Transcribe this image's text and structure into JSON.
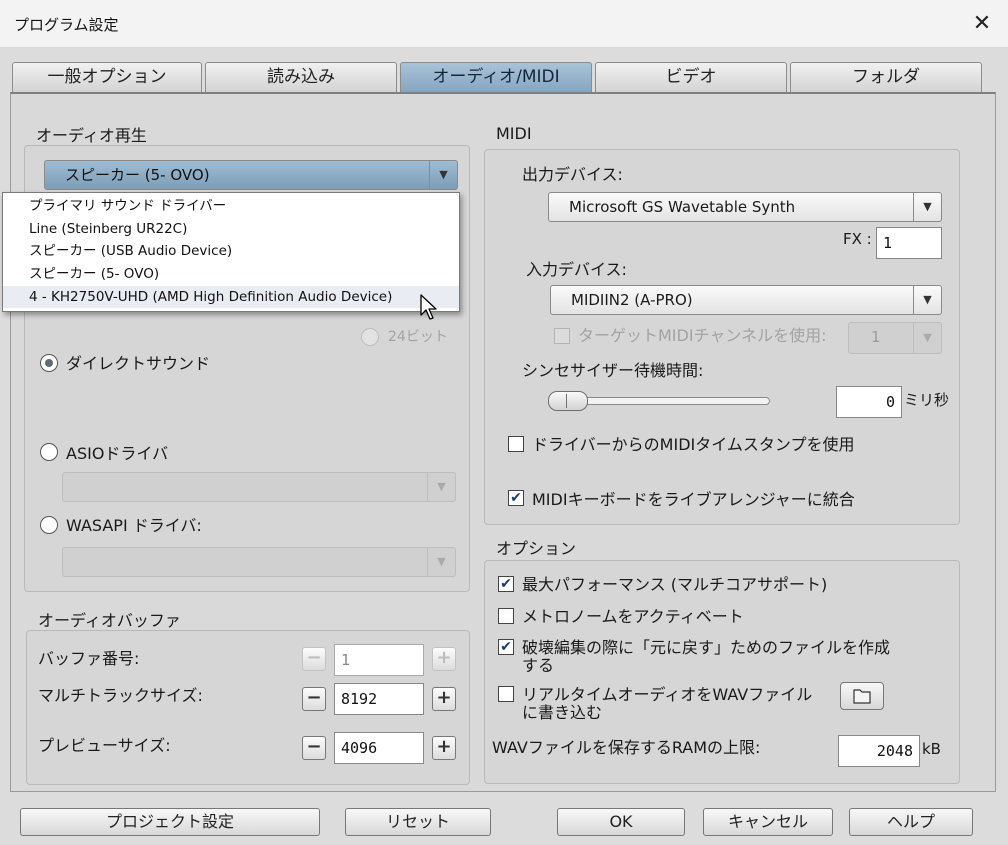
{
  "window": {
    "title": "プログラム設定",
    "close_glyph": "✕"
  },
  "tabs": [
    "一般オプション",
    "読み込み",
    "オーディオ/MIDI",
    "ビデオ",
    "フォルダ"
  ],
  "audio_playback": {
    "group_label": "オーディオ再生",
    "device_selected": "スピーカー (5- OVO)",
    "dropdown_items": [
      "プライマリ サウンド ドライバー",
      "Line (Steinberg UR22C)",
      "スピーカー (USB Audio Device)",
      "スピーカー (5- OVO)",
      "4 - KH2750V-UHD (AMD High Definition Audio Device)"
    ],
    "bit24_label": "24ビット",
    "directsound_label": "ダイレクトサウンド",
    "asio_label": "ASIOドライバ",
    "wasapi_label": "WASAPI ドライバ:"
  },
  "audio_buffer": {
    "group_label": "オーディオバッファ",
    "buffer_number_label": "バッファ番号:",
    "buffer_number_value": "1",
    "multitrack_label": "マルチトラックサイズ:",
    "multitrack_value": "8192",
    "preview_label": "プレビューサイズ:",
    "preview_value": "4096",
    "minus": "−",
    "plus": "+"
  },
  "midi": {
    "group_label": "MIDI",
    "output_label": "出力デバイス:",
    "output_value": "Microsoft GS Wavetable Synth",
    "fx_label": "FX :",
    "fx_value": "1",
    "input_label": "入力デバイス:",
    "input_value": "MIDIIN2 (A-PRO)",
    "target_channel_label": "ターゲットMIDIチャンネルを使用:",
    "target_channel_value": "1",
    "synth_wait_label": "シンセサイザー待機時間:",
    "synth_wait_value": "0",
    "synth_wait_unit": "ミリ秒",
    "timestamp_label": "ドライバーからのMIDIタイムスタンプを使用",
    "keyboard_label": "MIDIキーボードをライブアレンジャーに統合"
  },
  "options": {
    "group_label": "オプション",
    "max_perf_label": "最大パフォーマンス (マルチコアサポート)",
    "metronome_label": "メトロノームをアクティベート",
    "undo_label_1": "破壊編集の際に「元に戻す」ためのファイルを作成",
    "undo_label_2": "する",
    "realtime_label_1": "リアルタイムオーディオをWAVファイル",
    "realtime_label_2": "に書き込む",
    "ram_label": "WAVファイルを保存するRAMの上限:",
    "ram_value": "2048",
    "ram_unit": "kB"
  },
  "buttons": {
    "project": "プロジェクト設定",
    "reset": "リセット",
    "ok": "OK",
    "cancel": "キャンセル",
    "help": "ヘルプ"
  },
  "check_glyph": "✔",
  "arrow_glyph": "▼"
}
